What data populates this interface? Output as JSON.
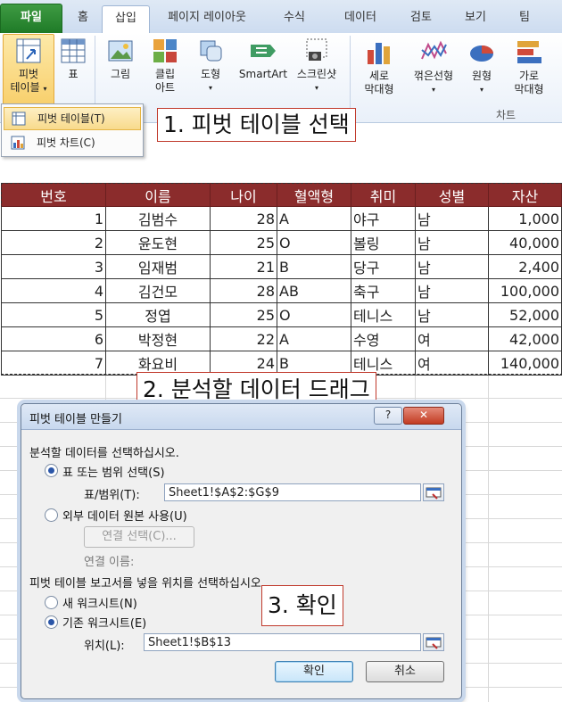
{
  "ribbon": {
    "tabs": [
      "파일",
      "홈",
      "삽입",
      "페이지 레이아웃",
      "수식",
      "데이터",
      "검토",
      "보기",
      "팀"
    ],
    "buttons": {
      "pivot": "피벗\n테이블",
      "table": "표",
      "picture": "그림",
      "clipart": "클립\n아트",
      "shapes": "도형",
      "smartart": "SmartArt",
      "screenshot": "스크린샷",
      "column": "세로\n막대형",
      "line": "꺾은선형",
      "pie": "원형",
      "bar": "가로\n막대형"
    },
    "group_chart": "차트",
    "dropdown": {
      "pivot_table": "피벗 테이블(T)",
      "pivot_chart": "피벗 차트(C)"
    }
  },
  "callouts": {
    "step1": "1. 피벗 테이블 선택",
    "step2": "2. 분석할 데이터 드래그",
    "step3": "3. 확인"
  },
  "sheet": {
    "headers": [
      "번호",
      "이름",
      "나이",
      "혈액형",
      "취미",
      "성별",
      "자산"
    ],
    "rows": [
      [
        "1",
        "김범수",
        "28",
        "A",
        "야구",
        "남",
        "1,000"
      ],
      [
        "2",
        "윤도현",
        "25",
        "O",
        "볼링",
        "남",
        "40,000"
      ],
      [
        "3",
        "임재범",
        "21",
        "B",
        "당구",
        "남",
        "2,400"
      ],
      [
        "4",
        "김건모",
        "28",
        "AB",
        "축구",
        "남",
        "100,000"
      ],
      [
        "5",
        "정엽",
        "25",
        "O",
        "테니스",
        "남",
        "52,000"
      ],
      [
        "6",
        "박정현",
        "22",
        "A",
        "수영",
        "여",
        "42,000"
      ],
      [
        "7",
        "화요비",
        "24",
        "B",
        "테니스",
        "여",
        "140,000"
      ]
    ]
  },
  "dialog": {
    "title": "피벗 테이블 만들기",
    "help": "?",
    "close": "✕",
    "section1": "분석할 데이터를 선택하십시오.",
    "opt_table_range": "표 또는 범위 선택(S)",
    "range_label": "표/범위(T):",
    "range_value": "Sheet1!$A$2:$G$9",
    "opt_external": "외부 데이터 원본 사용(U)",
    "connect_btn": "연결 선택(C)...",
    "connect_name": "연결 이름:",
    "section2": "피벗 테이블 보고서를 넣을 위치를 선택하십시오.",
    "opt_new_sheet": "새 워크시트(N)",
    "opt_existing_sheet": "기존 워크시트(E)",
    "location_label": "위치(L):",
    "location_value": "Sheet1!$B$13",
    "ok": "확인",
    "cancel": "취소"
  }
}
